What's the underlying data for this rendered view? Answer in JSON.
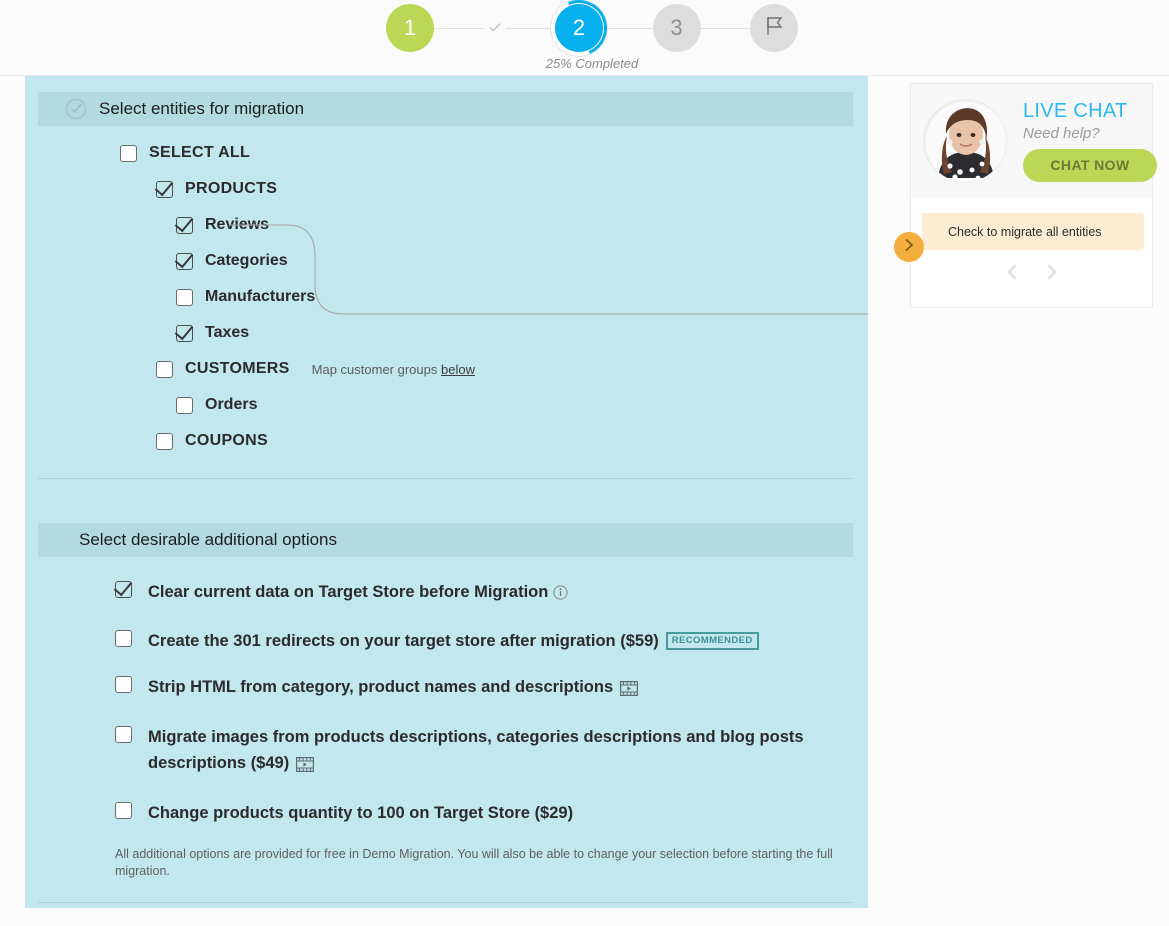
{
  "progress": {
    "steps": [
      {
        "label": "1",
        "state": "done"
      },
      {
        "label": "2",
        "state": "current"
      },
      {
        "label": "3",
        "state": "todo"
      }
    ],
    "finish_icon": "flag-icon",
    "check_icon": "check-icon",
    "completed_text": "25% Completed",
    "accent_done": "#bcd756",
    "accent_current": "#06b0ef",
    "accent_todo": "#dddddd"
  },
  "entities_section": {
    "title": "Select entities for migration",
    "header_icon": "circle-check-icon",
    "items": [
      {
        "label": "SELECT ALL",
        "checked": false,
        "level": 0,
        "style": "cap"
      },
      {
        "label": "PRODUCTS",
        "checked": true,
        "level": 1,
        "style": "cap"
      },
      {
        "label": "Reviews",
        "checked": true,
        "level": 2,
        "style": "norm"
      },
      {
        "label": "Categories",
        "checked": true,
        "level": 2,
        "style": "norm"
      },
      {
        "label": "Manufacturers",
        "checked": false,
        "level": 2,
        "style": "norm"
      },
      {
        "label": "Taxes",
        "checked": true,
        "level": 2,
        "style": "norm"
      },
      {
        "label": "CUSTOMERS",
        "checked": false,
        "level": 1,
        "style": "cap",
        "hint_prefix": "Map customer groups ",
        "hint_link": "below"
      },
      {
        "label": "Orders",
        "checked": false,
        "level": 2,
        "style": "norm"
      },
      {
        "label": "COUPONS",
        "checked": false,
        "level": 1,
        "style": "cap"
      }
    ]
  },
  "options_section": {
    "title": "Select desirable additional options",
    "options": [
      {
        "label": "Clear current data on Target Store before Migration",
        "checked": true,
        "icon": "info-icon"
      },
      {
        "label": "Create the 301 redirects on your target store after migration ($59)",
        "checked": false,
        "badge": "RECOMMENDED"
      },
      {
        "label": "Strip HTML from category, product names and descriptions",
        "checked": false,
        "icon": "video-icon"
      },
      {
        "label": "Migrate images from products descriptions, categories descriptions and blog posts descriptions ($49)",
        "checked": false,
        "icon": "video-icon"
      },
      {
        "label": "Change products quantity to 100 on Target Store ($29)",
        "checked": false
      }
    ],
    "note": "All additional options are provided for free in Demo Migration. You will also be able to change your selection before starting the full migration."
  },
  "sidebar": {
    "chat": {
      "avatar_name": "support-agent-avatar",
      "title": "LIVE CHAT",
      "subtitle": "Need help?",
      "button_label": "CHAT NOW",
      "title_color": "#2bb8f2",
      "button_color": "#bcd756"
    },
    "tip": {
      "text": "Check to migrate all entities",
      "arrow_icon": "chevron-right-icon",
      "bg_color": "#fdecd4",
      "arrow_color": "#f4ae3e"
    },
    "carousel": {
      "prev_icon": "chevron-left-icon",
      "next_icon": "chevron-right-icon"
    }
  }
}
